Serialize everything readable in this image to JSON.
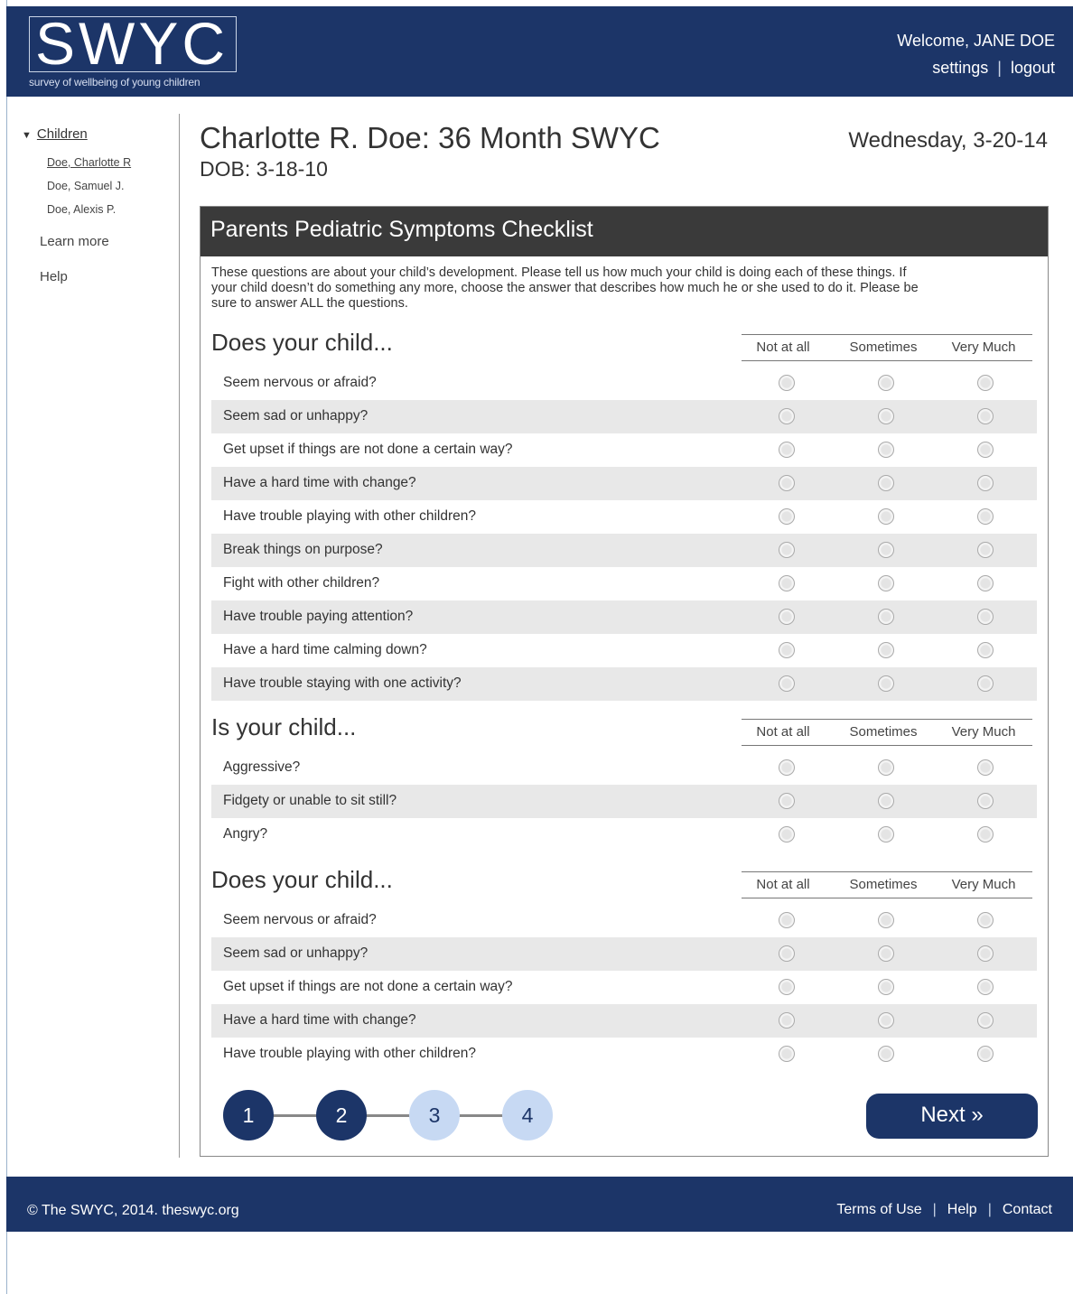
{
  "header": {
    "logo": "SWYC",
    "tagline": "survey of wellbeing of young children",
    "welcome": "Welcome, JANE DOE",
    "settings": "settings",
    "logout": "logout",
    "separator": "|"
  },
  "sidebar": {
    "children_label": "Children",
    "children_arrow": "▼",
    "children": [
      "Doe, Charlotte R",
      "Doe, Samuel J.",
      "Doe, Alexis P."
    ],
    "learn_more": "Learn more",
    "help": "Help"
  },
  "page": {
    "title": "Charlotte R. Doe: 36 Month SWYC",
    "dob": "DOB: 3-18-10",
    "date": "Wednesday, 3-20-14"
  },
  "checklist": {
    "title": "Parents Pediatric Symptoms Checklist",
    "intro": "These questions are about your child’s development. Please tell us how much your child is doing each of these things. If your child doesn’t do something any more, choose the answer that describes how much he or she used to do it. Please be sure to answer ALL the questions.",
    "columns": [
      "Not at all",
      "Sometimes",
      "Very Much"
    ],
    "sections": [
      {
        "title": "Does your child...",
        "questions": [
          "Seem nervous or afraid?",
          "Seem sad or unhappy?",
          "Get upset if things are not done a certain way?",
          "Have a hard time with change?",
          "Have trouble playing with other children?",
          "Break things on purpose?",
          "Fight with other children?",
          "Have trouble paying attention?",
          "Have a hard time calming down?",
          "Have trouble staying with one activity?"
        ]
      },
      {
        "title": "Is your child...",
        "questions": [
          "Aggressive?",
          "Fidgety or unable to sit still?",
          "Angry?"
        ]
      },
      {
        "title": "Does your child...",
        "questions": [
          "Seem nervous or afraid?",
          "Seem sad or unhappy?",
          "Get upset if things are not done a certain way?",
          "Have a hard time with change?",
          "Have trouble playing with other children?"
        ]
      }
    ]
  },
  "progress": {
    "steps": [
      "1",
      "2",
      "3",
      "4"
    ],
    "completed": 2
  },
  "next_button": "Next »",
  "footer": {
    "copyright": "© The SWYC, 2014. theswyc.org",
    "terms": "Terms of Use",
    "help": "Help",
    "contact": "Contact",
    "separator": "|"
  }
}
